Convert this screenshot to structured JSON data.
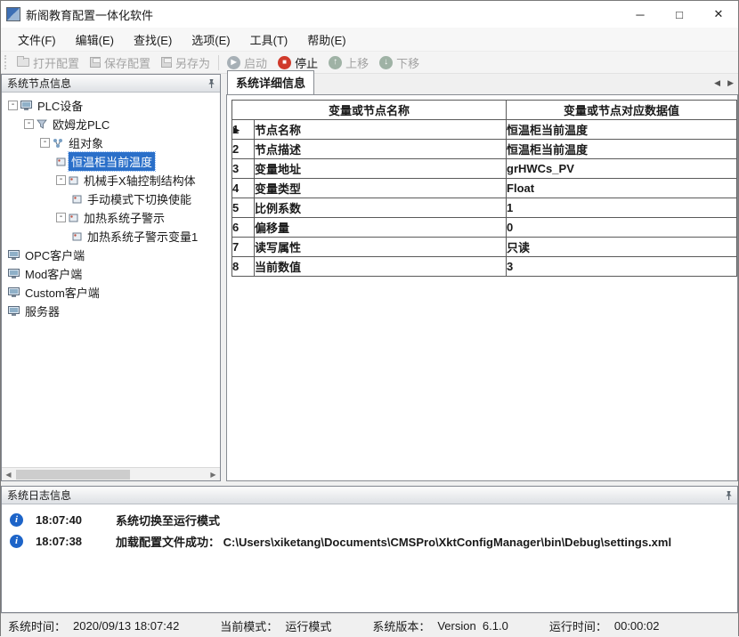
{
  "window": {
    "title": "新阁教育配置一体化软件"
  },
  "icons": {
    "minimize": "─",
    "maximize": "□",
    "close": "✕",
    "collapse": "-",
    "row_marker": "▶",
    "scroll_left": "◀",
    "scroll_right": "▶",
    "tab_prev": "◀",
    "tab_next": "▶",
    "info": "i",
    "play": "▶",
    "stop_square": "■",
    "arrow_up": "↑",
    "arrow_down": "↓"
  },
  "menu": {
    "items": [
      {
        "label": "文件(F)"
      },
      {
        "label": "编辑(E)"
      },
      {
        "label": "查找(E)"
      },
      {
        "label": "选项(E)"
      },
      {
        "label": "工具(T)"
      },
      {
        "label": "帮助(E)"
      }
    ]
  },
  "toolbar": {
    "open": "打开配置",
    "save": "保存配置",
    "save_as": "另存为",
    "start": "启动",
    "stop": "停止",
    "move_up": "上移",
    "move_down": "下移"
  },
  "node_panel": {
    "title": "系统节点信息",
    "items": [
      {
        "label": "PLC设备"
      },
      {
        "label": "欧姆龙PLC"
      },
      {
        "label": "组对象"
      },
      {
        "label": "恒温柜当前温度"
      },
      {
        "label": "机械手X轴控制结构体"
      },
      {
        "label": "手动模式下切换使能"
      },
      {
        "label": "加热系统子警示"
      },
      {
        "label": "加热系统子警示变量1"
      },
      {
        "label": "OPC客户端"
      },
      {
        "label": "Mod客户端"
      },
      {
        "label": "Custom客户端"
      },
      {
        "label": "服务器"
      }
    ]
  },
  "detail": {
    "tab": "系统详细信息",
    "columns": [
      "变量或节点名称",
      "变量或节点对应数据值"
    ],
    "rows": [
      {
        "num": "1",
        "name": "节点名称",
        "value": "恒温柜当前温度"
      },
      {
        "num": "2",
        "name": "节点描述",
        "value": "恒温柜当前温度"
      },
      {
        "num": "3",
        "name": "变量地址",
        "value": "grHWCs_PV"
      },
      {
        "num": "4",
        "name": "变量类型",
        "value": "Float"
      },
      {
        "num": "5",
        "name": "比例系数",
        "value": "1"
      },
      {
        "num": "6",
        "name": "偏移量",
        "value": "0"
      },
      {
        "num": "7",
        "name": "读写属性",
        "value": "只读"
      },
      {
        "num": "8",
        "name": "当前数值",
        "value": "3"
      }
    ]
  },
  "log": {
    "title": "系统日志信息",
    "entries": [
      {
        "time": "18:07:40",
        "message": "系统切换至运行模式"
      },
      {
        "time": "18:07:38",
        "message": "加载配置文件成功： C:\\Users\\xiketang\\Documents\\CMSPro\\XktConfigManager\\bin\\Debug\\settings.xml"
      }
    ]
  },
  "status": {
    "time_label": "系统时间：",
    "time_value": "2020/09/13 18:07:42",
    "mode_label": "当前模式：",
    "mode_value": "运行模式",
    "version_label": "系统版本：",
    "version_value": "Version  6.1.0",
    "uptime_label": "运行时间：",
    "uptime_value": "00:00:02"
  }
}
